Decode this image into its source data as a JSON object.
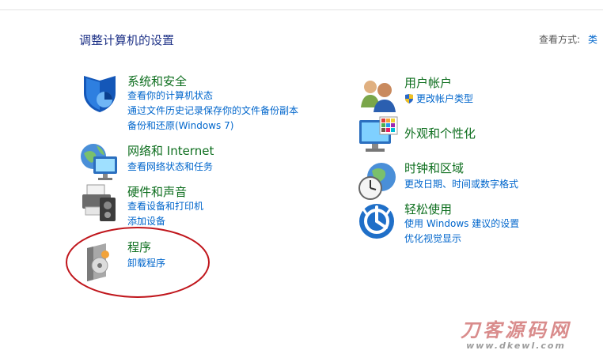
{
  "header": {
    "title": "调整计算机的设置",
    "view_by_label": "查看方式:",
    "view_by_value": "类"
  },
  "categories_left": [
    {
      "title": "系统和安全",
      "icon": "shield-icon",
      "links": [
        "查看你的计算机状态",
        "通过文件历史记录保存你的文件备份副本",
        "备份和还原(Windows 7)"
      ]
    },
    {
      "title": "网络和 Internet",
      "icon": "network-globe-icon",
      "links": [
        "查看网络状态和任务"
      ]
    },
    {
      "title": "硬件和声音",
      "icon": "printer-speaker-icon",
      "links": [
        "查看设备和打印机",
        "添加设备"
      ]
    },
    {
      "title": "程序",
      "icon": "program-disc-icon",
      "links": [
        "卸载程序"
      ]
    }
  ],
  "categories_right": [
    {
      "title": "用户帐户",
      "icon": "users-icon",
      "links": [
        "更改帐户类型"
      ]
    },
    {
      "title": "外观和个性化",
      "icon": "monitor-palette-icon",
      "links": []
    },
    {
      "title": "时钟和区域",
      "icon": "clock-globe-icon",
      "links": [
        "更改日期、时间或数字格式"
      ]
    },
    {
      "title": "轻松使用",
      "icon": "ease-of-access-icon",
      "links": [
        "使用 Windows 建议的设置",
        "优化视觉显示"
      ]
    }
  ],
  "watermark": {
    "line1": "刀客源码网",
    "line2": "www.dkewl.com"
  },
  "colors": {
    "title_blue": "#1e3287",
    "category_green": "#0d6e1e",
    "link_blue": "#0066cc",
    "annotation_red": "#c0161c"
  }
}
